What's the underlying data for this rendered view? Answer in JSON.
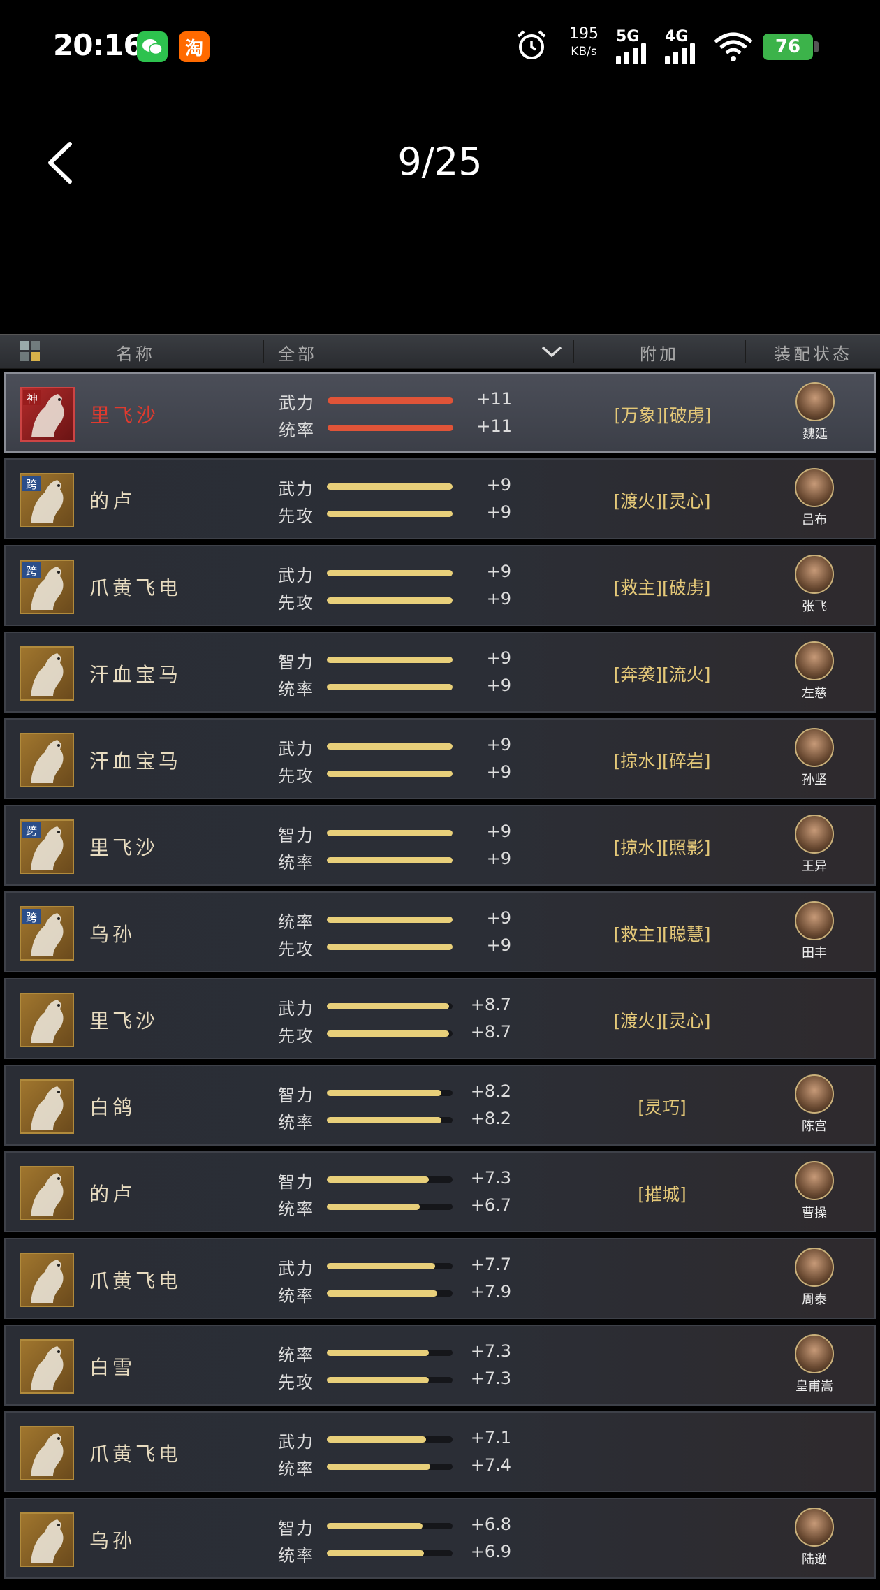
{
  "status": {
    "time": "20:16",
    "net_speed": "195",
    "net_unit": "KB/s",
    "sig1": "5G",
    "sig2": "4G",
    "battery": "76"
  },
  "header": {
    "page": "9/25"
  },
  "table_head": {
    "name": "名称",
    "filter": "全部",
    "extra": "附加",
    "equip": "装配状态"
  },
  "rows": [
    {
      "badge": "神",
      "name": "里飞沙",
      "s1": {
        "label": "武力",
        "value": "+11",
        "fill": 1.0
      },
      "s2": {
        "label": "统率",
        "value": "+11",
        "fill": 1.0
      },
      "extras": "[万象][破虏]",
      "general": "魏延",
      "highlight": true
    },
    {
      "badge": "跨",
      "name": "的卢",
      "s1": {
        "label": "武力",
        "value": "+9",
        "fill": 1.0
      },
      "s2": {
        "label": "先攻",
        "value": "+9",
        "fill": 1.0
      },
      "extras": "[渡火][灵心]",
      "general": "吕布"
    },
    {
      "badge": "跨",
      "name": "爪黄飞电",
      "s1": {
        "label": "武力",
        "value": "+9",
        "fill": 1.0
      },
      "s2": {
        "label": "先攻",
        "value": "+9",
        "fill": 1.0
      },
      "extras": "[救主][破虏]",
      "general": "张飞"
    },
    {
      "badge": "",
      "name": "汗血宝马",
      "s1": {
        "label": "智力",
        "value": "+9",
        "fill": 1.0
      },
      "s2": {
        "label": "统率",
        "value": "+9",
        "fill": 1.0
      },
      "extras": "[奔袭][流火]",
      "general": "左慈"
    },
    {
      "badge": "",
      "name": "汗血宝马",
      "s1": {
        "label": "武力",
        "value": "+9",
        "fill": 1.0
      },
      "s2": {
        "label": "先攻",
        "value": "+9",
        "fill": 1.0
      },
      "extras": "[掠水][碎岩]",
      "general": "孙坚"
    },
    {
      "badge": "跨",
      "name": "里飞沙",
      "s1": {
        "label": "智力",
        "value": "+9",
        "fill": 1.0
      },
      "s2": {
        "label": "统率",
        "value": "+9",
        "fill": 1.0
      },
      "extras": "[掠水][照影]",
      "general": "王异"
    },
    {
      "badge": "跨",
      "name": "乌孙",
      "s1": {
        "label": "统率",
        "value": "+9",
        "fill": 1.0
      },
      "s2": {
        "label": "先攻",
        "value": "+9",
        "fill": 1.0
      },
      "extras": "[救主][聪慧]",
      "general": "田丰"
    },
    {
      "badge": "",
      "name": "里飞沙",
      "s1": {
        "label": "武力",
        "value": "+8.7",
        "fill": 0.97
      },
      "s2": {
        "label": "先攻",
        "value": "+8.7",
        "fill": 0.97
      },
      "extras": "[渡火][灵心]",
      "general": ""
    },
    {
      "badge": "",
      "name": "白鸽",
      "s1": {
        "label": "智力",
        "value": "+8.2",
        "fill": 0.91
      },
      "s2": {
        "label": "统率",
        "value": "+8.2",
        "fill": 0.91
      },
      "extras": "[灵巧]",
      "general": "陈宫"
    },
    {
      "badge": "",
      "name": "的卢",
      "s1": {
        "label": "智力",
        "value": "+7.3",
        "fill": 0.81
      },
      "s2": {
        "label": "统率",
        "value": "+6.7",
        "fill": 0.74
      },
      "extras": "[摧城]",
      "general": "曹操"
    },
    {
      "badge": "",
      "name": "爪黄飞电",
      "s1": {
        "label": "武力",
        "value": "+7.7",
        "fill": 0.86
      },
      "s2": {
        "label": "统率",
        "value": "+7.9",
        "fill": 0.88
      },
      "extras": "",
      "general": "周泰"
    },
    {
      "badge": "",
      "name": "白雪",
      "s1": {
        "label": "统率",
        "value": "+7.3",
        "fill": 0.81
      },
      "s2": {
        "label": "先攻",
        "value": "+7.3",
        "fill": 0.81
      },
      "extras": "",
      "general": "皇甫嵩"
    },
    {
      "badge": "",
      "name": "爪黄飞电",
      "s1": {
        "label": "武力",
        "value": "+7.1",
        "fill": 0.79
      },
      "s2": {
        "label": "统率",
        "value": "+7.4",
        "fill": 0.82
      },
      "extras": "",
      "general": ""
    },
    {
      "badge": "",
      "name": "乌孙",
      "s1": {
        "label": "智力",
        "value": "+6.8",
        "fill": 0.76
      },
      "s2": {
        "label": "统率",
        "value": "+6.9",
        "fill": 0.77
      },
      "extras": "",
      "general": "陆逊"
    }
  ]
}
